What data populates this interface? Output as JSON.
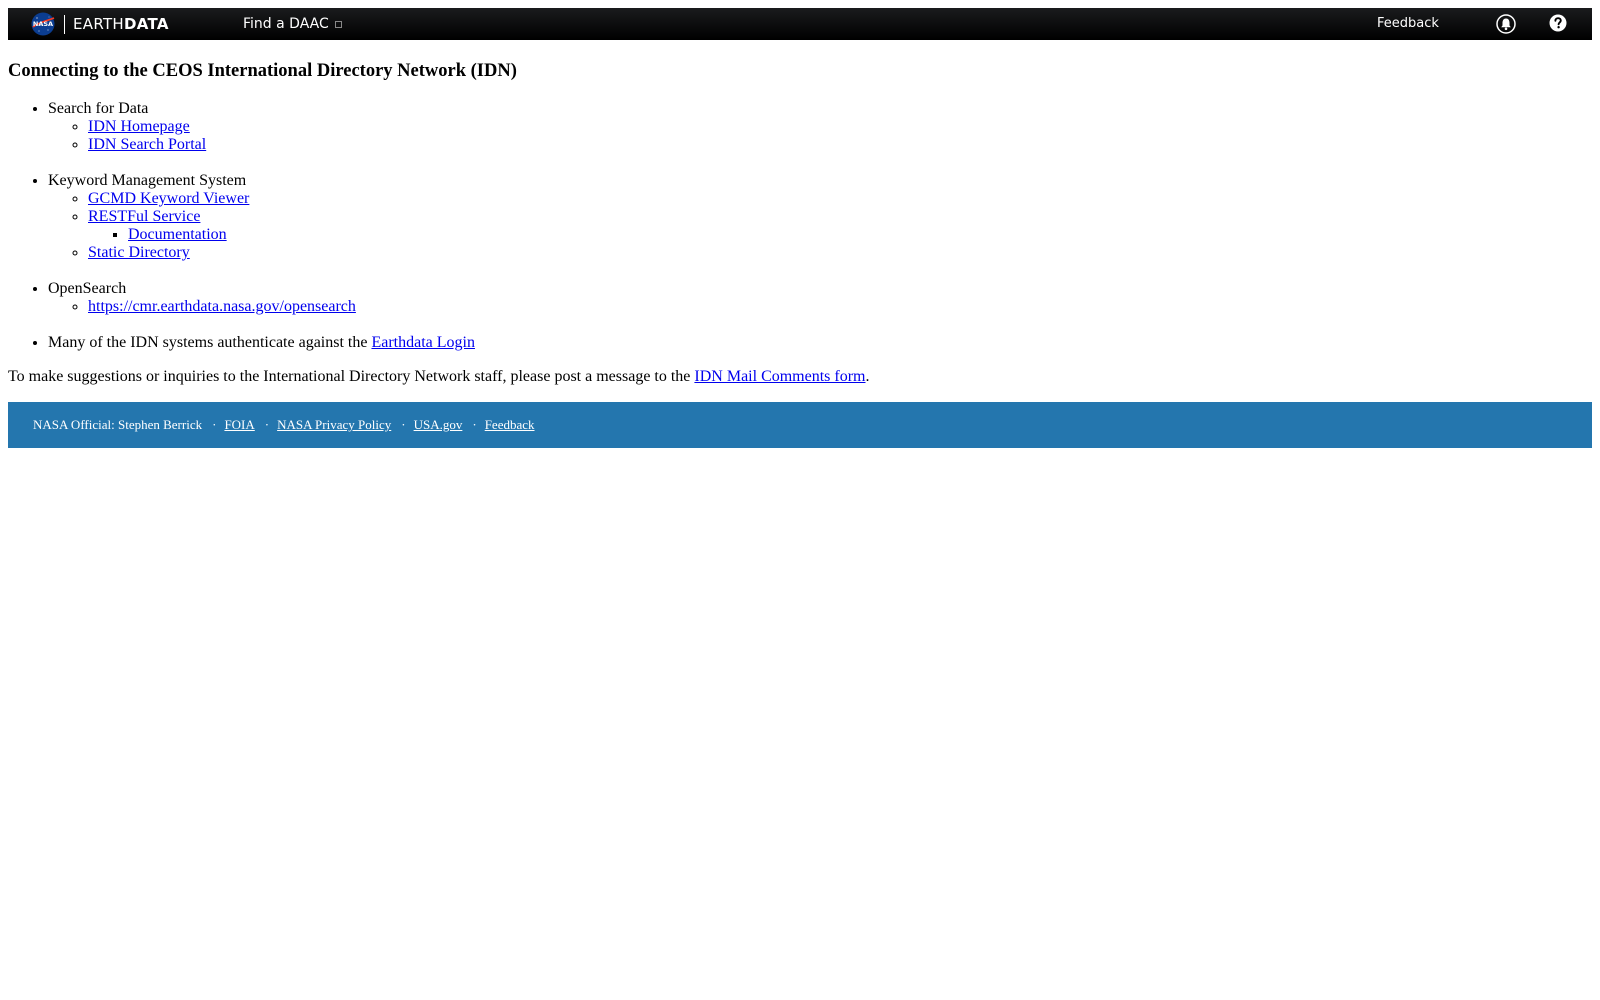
{
  "header": {
    "brand_light": "EARTH",
    "brand_bold": "DATA",
    "find_daac": "Find a DAAC",
    "feedback": "Feedback",
    "icons": [
      "nasa-logo",
      "bell-icon",
      "help-icon"
    ]
  },
  "title": "Connecting to the CEOS International Directory Network (IDN)",
  "sections": {
    "search": {
      "label": "Search for Data",
      "links": [
        "IDN Homepage",
        "IDN Search Portal"
      ]
    },
    "kms": {
      "label": "Keyword Management System",
      "links": [
        "GCMD Keyword Viewer",
        "RESTFul Service",
        "Static Directory"
      ],
      "sublinks": [
        "Documentation"
      ]
    },
    "opensearch": {
      "label": "OpenSearch",
      "links": [
        "https://cmr.earthdata.nasa.gov/opensearch"
      ]
    },
    "auth": {
      "text": "Many of the IDN systems authenticate against the",
      "link": "Earthdata Login"
    }
  },
  "suggest": {
    "text": "To make suggestions or inquiries to the International Directory Network staff, please post a message to the",
    "link": "IDN Mail Comments form",
    "end": "."
  },
  "footer": {
    "official": "NASA Official: Stephen Berrick",
    "separator": "·",
    "links": [
      "FOIA",
      "NASA Privacy Policy",
      "USA.gov",
      "Feedback"
    ]
  },
  "colors": {
    "topbar": "#000000",
    "footer": "#2476ae",
    "link": "#0000ee"
  }
}
